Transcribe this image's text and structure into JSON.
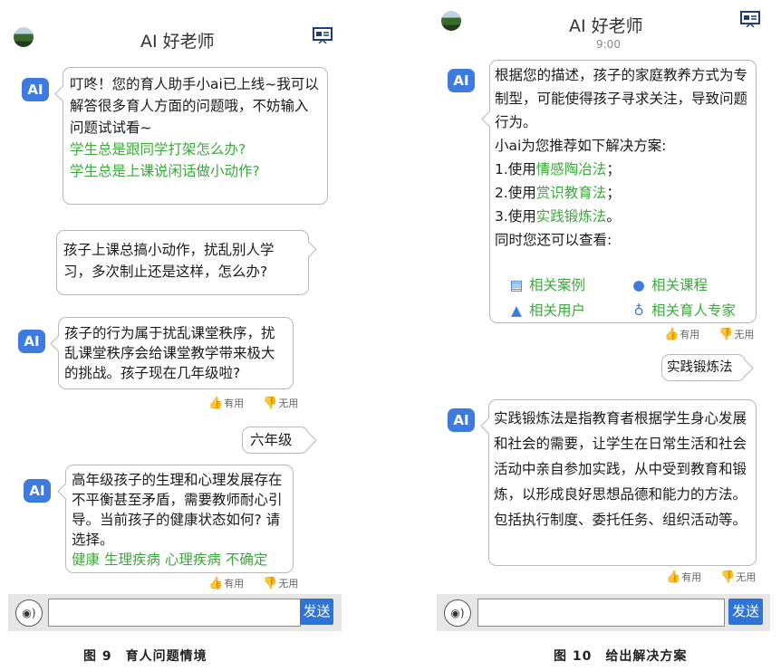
{
  "left": {
    "header": {
      "title": "AI 好老师"
    },
    "bubbles": {
      "greeting": {
        "text": "叮咚！您的育人助手小ai已上线~我可以解答很多育人方面的问题哦，不妨输入问题试试看~",
        "suggestions": [
          "学生总是跟同学打架怎么办?",
          "学生总是上课说闲话做小动作?"
        ]
      },
      "user_q": "孩子上课总搞小动作，扰乱别人学习，多次制止还是这样，怎么办?",
      "ai_a1": "孩子的行为属于扰乱课堂秩序，扰乱课堂秩序会给课堂教学带来极大的挑战。孩子现在几年级啦?",
      "user_grade": "六年级",
      "ai_a2": {
        "text": "高年级孩子的生理和心理发展存在不平衡甚至矛盾，需要教师耐心引导。当前孩子的健康状态如何? 请选择。",
        "options": [
          "健康",
          "生理疾病",
          "心理疾病",
          "不确定"
        ]
      }
    },
    "feedback": {
      "useful": "有用",
      "useless": "无用"
    },
    "input_bar": {
      "send": "发送",
      "placeholder": ""
    },
    "caption": "图 9　育人问题情境"
  },
  "right": {
    "header": {
      "title": "AI 好老师",
      "time": "9:00"
    },
    "bubbles": {
      "solution": {
        "intro": "根据您的描述，孩子的家庭教养方式为专制型，可能使得孩子寻求关注，导致问题行为。",
        "recommend": "小ai为您推荐如下解决方案:",
        "items": [
          {
            "prefix": "1.使用",
            "link": "情感陶冶法",
            "suffix": "；"
          },
          {
            "prefix": "2.使用",
            "link": "赏识教育法",
            "suffix": "；"
          },
          {
            "prefix": "3.使用",
            "link": "实践锻炼法",
            "suffix": "。"
          }
        ],
        "also": "同时您还可以查看:",
        "links": [
          {
            "icon": "case-doc-icon",
            "label": "相关案例"
          },
          {
            "icon": "video-course-icon",
            "label": "相关课程"
          },
          {
            "icon": "user-icon",
            "label": "相关用户"
          },
          {
            "icon": "expert-badge-icon",
            "label": "相关育人专家"
          }
        ]
      },
      "user_choice": "实践锻炼法",
      "explain": "实践锻炼法是指教育者根据学生身心发展和社会的需要，让学生在日常生活和社会活动中亲自参加实践，从中受到教育和锻炼，以形成良好思想品德和能力的方法。包括执行制度、委托任务、组织活动等。"
    },
    "feedback": {
      "useful": "有用",
      "useless": "无用"
    },
    "input_bar": {
      "send": "发送",
      "placeholder": ""
    },
    "caption": "图 10　给出解决方案"
  },
  "colors": {
    "accent_blue": "#2d74d6",
    "suggestion_green": "#3aaa3a",
    "ai_badge": "#3d7be0"
  },
  "icons": {
    "ai": "AI",
    "voice": "voice-icon",
    "board": "presentation-board-icon"
  }
}
